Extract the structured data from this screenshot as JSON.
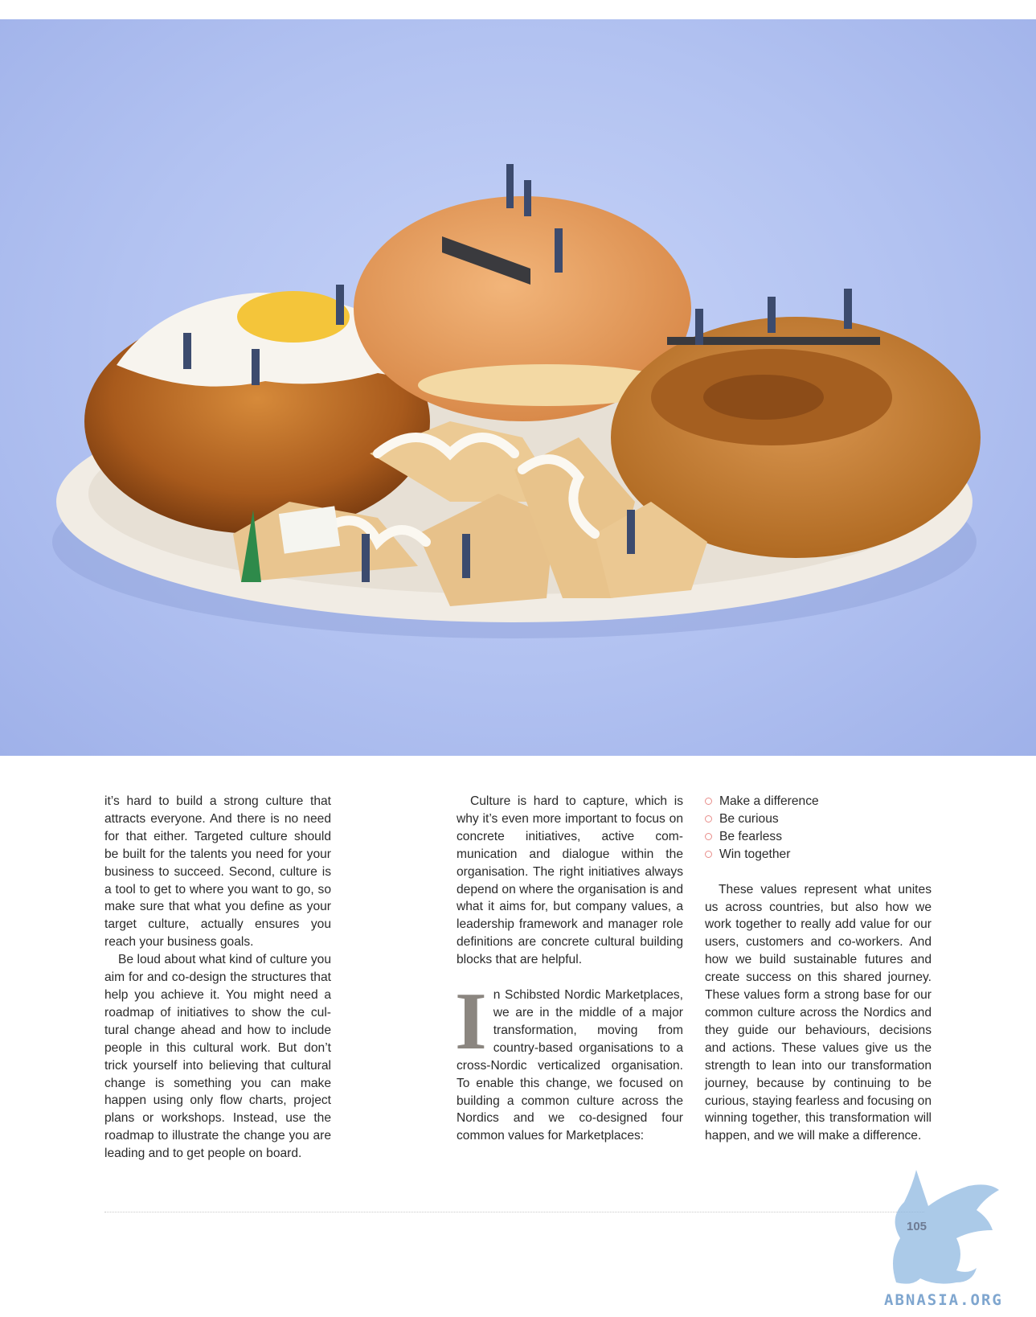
{
  "photo": {
    "icon": "pastry-plate-with-miniature-figures-photo"
  },
  "columns": {
    "col1": {
      "p1": "it’s hard to build a strong culture that attracts everyone. And there is no need for that either. Targeted culture should be built for the talents you need for your business to succeed. Second, culture is a tool to get to where you want to go, so make sure that what you define as your target culture, actually ensures you reach your business goals.",
      "p2": "Be loud about what kind of culture you aim for and co-design the structures that help you achieve it. You might need a roadmap of initiatives to show the cul­tural change ahead and how to include people in this cultural work. But don’t trick yourself into believing that cultural change is something you can make happen using only flow charts, project plans or workshops. Instead, use the roadmap to illustrate the change you are leading and to get people on board."
    },
    "col2": {
      "p1": "Culture is hard to capture, which is why it’s even more important to focus on concrete initiatives, active com­munication and dialogue within the organisation. The right initiatives al­ways depend on where the organ­isation is and what it aims for, but company values, a leadership frame­work and manager role definitions are concrete cultural building blocks that are helpful.",
      "dropcap": "I",
      "p2": "n Schibsted Nordic Market­places, we are in the middle of a major transformation, moving from country-based organisa­tions to a cross-Nordic verticalized organisation. To enable this change, we focused on building a common culture across the Nordics and we co-designed four common values for Marketplaces:"
    },
    "col3": {
      "values": [
        "Make a difference",
        "Be curious",
        "Be fearless",
        "Win together"
      ],
      "p1": "These values represent what unites us across countries, but also how we work together to really add value for our users, customers and co-workers. And how we build sustainable futures and create success on this shared journey. These values form a strong base for our common culture across the Nordics and they guide our behaviours, decisions and actions. These values give us the strength to lean into our transforma­tion journey, because by continuing to be curious, staying fearless and focu­sing on winning together, this transfor­mation will happen, and we will make a difference."
    }
  },
  "footer": {
    "page_number": "105"
  },
  "watermark": {
    "text": "ABNASIA.ORG",
    "icon": "griffin-logo-icon"
  },
  "colors": {
    "background": "#b4c3f2",
    "bullet": "#e88d8a",
    "dropcap": "#8b8680",
    "watermark": "#7fa6cf"
  }
}
